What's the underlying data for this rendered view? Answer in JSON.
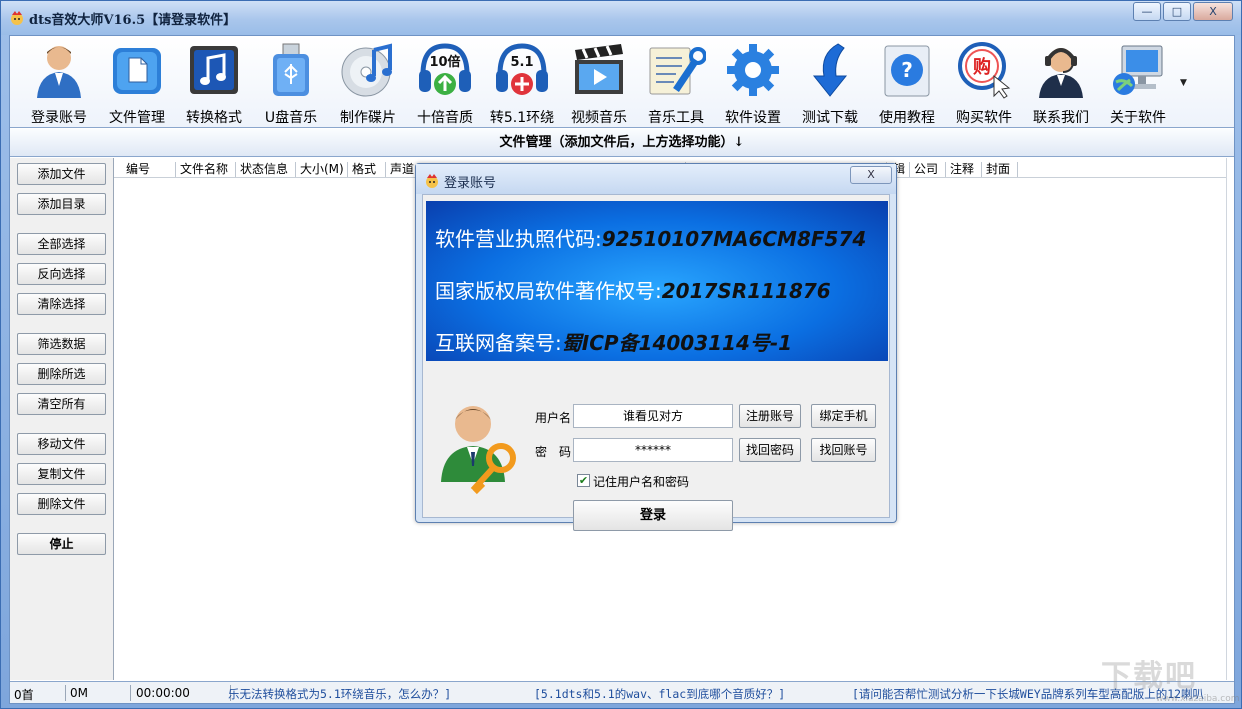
{
  "window": {
    "title": "dts音效大师V16.5【请登录软件】",
    "controls": {
      "minimize": "—",
      "maximize": "□",
      "close": "X"
    }
  },
  "toolbar": {
    "items": [
      {
        "label": "登录账号",
        "icon": "user-icon"
      },
      {
        "label": "文件管理",
        "icon": "folder-icon"
      },
      {
        "label": "转换格式",
        "icon": "music-note-icon"
      },
      {
        "label": "U盘音乐",
        "icon": "usb-icon"
      },
      {
        "label": "制作碟片",
        "icon": "cd-icon"
      },
      {
        "label": "十倍音质",
        "icon": "headphones-10x-icon",
        "badge": "10倍"
      },
      {
        "label": "转5.1环绕",
        "icon": "headphones-51-icon",
        "badge": "5.1"
      },
      {
        "label": "视频音乐",
        "icon": "clapper-icon"
      },
      {
        "label": "音乐工具",
        "icon": "tools-icon"
      },
      {
        "label": "软件设置",
        "icon": "gear-icon"
      },
      {
        "label": "测试下载",
        "icon": "download-arrow-icon"
      },
      {
        "label": "使用教程",
        "icon": "help-icon"
      },
      {
        "label": "购买软件",
        "icon": "buy-icon",
        "badge": "购"
      },
      {
        "label": "联系我们",
        "icon": "support-agent-icon"
      },
      {
        "label": "关于软件",
        "icon": "computer-icon"
      }
    ],
    "more": "▼"
  },
  "file_manager": {
    "title": "文件管理（添加文件后，上方选择功能）↓",
    "columns": [
      "编号",
      "文件名称",
      "状态信息",
      "大小(M)",
      "格式",
      "声道",
      "专辑",
      "公司",
      "注释",
      "封面"
    ]
  },
  "sidebar": {
    "buttons": [
      "添加文件",
      "添加目录",
      "全部选择",
      "反向选择",
      "清除选择",
      "筛选数据",
      "删除所选",
      "清空所有",
      "移动文件",
      "复制文件",
      "删除文件",
      "停止"
    ]
  },
  "statusbar": {
    "count": "0首",
    "size": "0M",
    "time": "00:00:00",
    "links": [
      "乐无法转换格式为5.1环绕音乐，怎么办？]",
      "[5.1dts和5.1的wav、flac到底哪个音质好？]",
      "[请问能否帮忙测试分析一下长城WEY品牌系列车型高配版上的12喇叭"
    ]
  },
  "watermark": {
    "main": "下载吧",
    "sub": "www.xiazaiba.com"
  },
  "dialog": {
    "title": "登录账号",
    "close": "X",
    "banner": [
      {
        "label": "软件营业执照代码:",
        "value": "92510107MA6CM8F574"
      },
      {
        "label": "国家版权局软件著作权号:",
        "value": "2017SR111876"
      },
      {
        "label": "互联网备案号:",
        "value": "蜀ICP备14003114号-1"
      }
    ],
    "username_label": "用户名",
    "username_value": "谁看见对方",
    "password_label": "密　码",
    "password_value": "******",
    "register_button": "注册账号",
    "bind_phone_button": "绑定手机",
    "find_password_button": "找回密码",
    "find_account_button": "找回账号",
    "remember_label": "记住用户名和密码",
    "remember_checked": true,
    "login_button": "登录"
  },
  "colors": {
    "title_bg": "#a9c6ec",
    "banner_blue": "#0b6fe2",
    "link": "#1f4e9d"
  }
}
